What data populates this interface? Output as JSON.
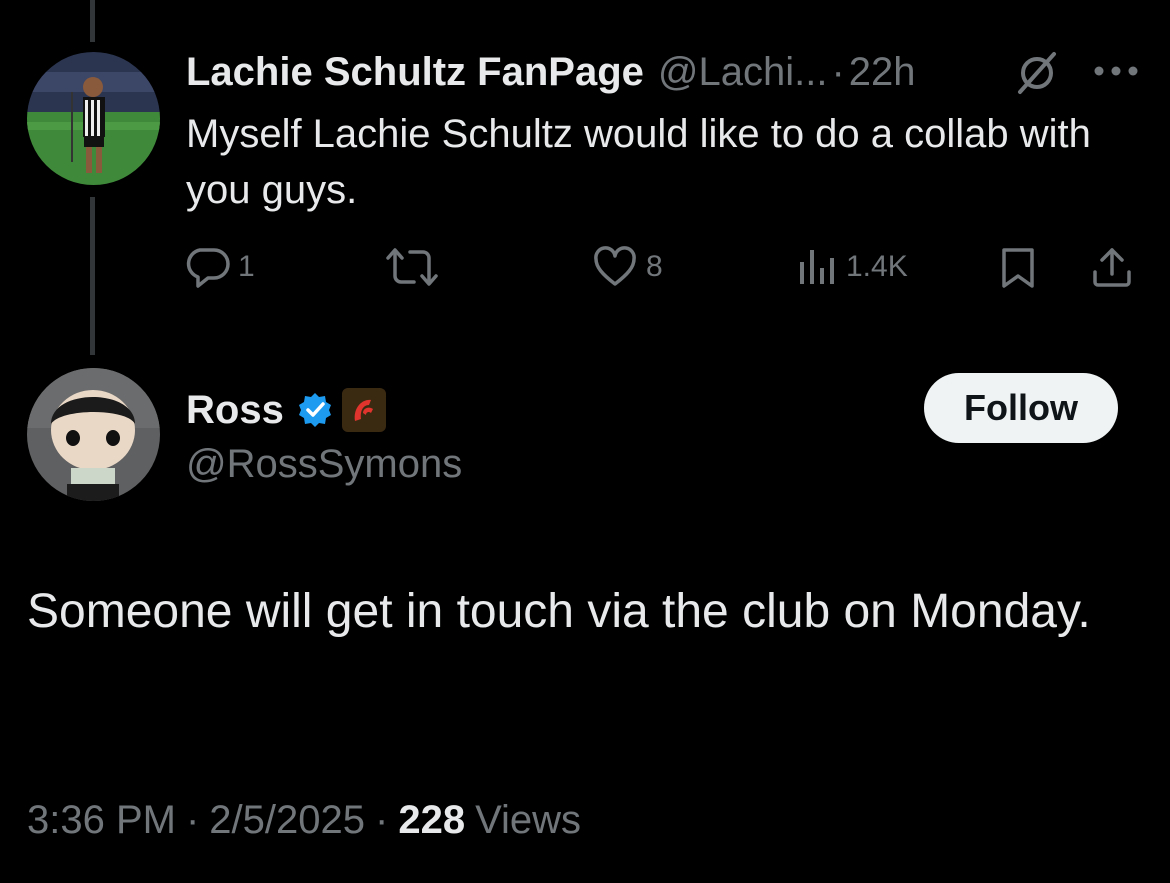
{
  "parent_tweet": {
    "display_name": "Lachie Schultz FanPage",
    "handle": "@Lachi...",
    "separator": "·",
    "time": "22h",
    "text": "Myself Lachie Schultz would like to do a collab with you guys.",
    "mute_icon": "mute-icon",
    "more_icon": "more-icon",
    "actions": {
      "replies": "1",
      "retweets": "",
      "likes": "8",
      "views": "1.4K"
    }
  },
  "main_tweet": {
    "display_name": "Ross",
    "verified_icon": "verified-badge-icon",
    "affiliate_icon": "affiliate-badge-icon",
    "handle": "@RossSymons",
    "follow_label": "Follow",
    "text": "Someone will get in touch via the club on Monday.",
    "time": "3:36 PM",
    "date": "2/5/2025",
    "separator": "·",
    "views_count": "228",
    "views_label": "Views"
  },
  "colors": {
    "background": "#000000",
    "text_primary": "#e7e9ea",
    "text_secondary": "#71767b",
    "thread_line": "#333639",
    "verified_blue": "#1d9bf0",
    "follow_bg": "#eff3f4"
  }
}
